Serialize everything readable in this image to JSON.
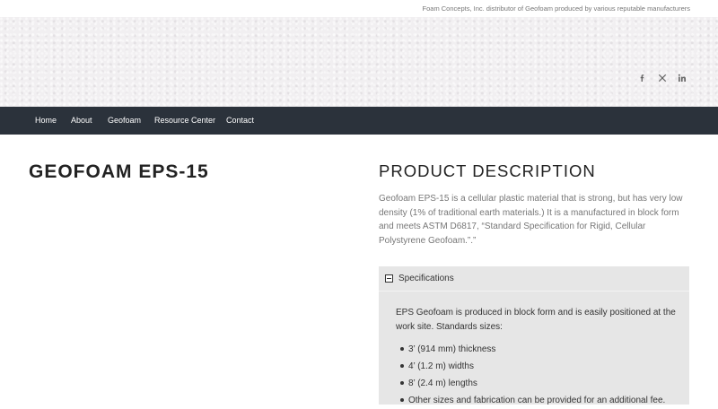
{
  "topbar": {
    "tagline": "Foam Concepts, Inc. distributor of Geofoam produced by various reputable manufacturers"
  },
  "social": {
    "icons": [
      "facebook-icon",
      "x-twitter-icon",
      "linkedin-icon"
    ]
  },
  "nav": {
    "items": [
      "Home",
      "About",
      "Geofoam",
      "Resource Center",
      "Contact"
    ]
  },
  "page": {
    "title": "GEOFOAM EPS-15"
  },
  "product": {
    "heading": "PRODUCT DESCRIPTION",
    "description": "Geofoam EPS-15 is a cellular plastic material that is strong, but has very low density (1% of traditional earth materials.) It is a manufactured in block form and meets ASTM D6817, “Standard Specification for Rigid, Cellular Polystyrene Geofoam.”.”"
  },
  "specs": {
    "label": "Specifications",
    "intro": "EPS Geofoam is produced in block form and is easily positioned at the work site. Standards sizes:",
    "items": [
      "3’ (914 mm) thickness",
      "4’ (1.2 m) widths",
      "8’ (2.4 m) lengths",
      "Other sizes and fabrication can be provided for an additional fee."
    ]
  },
  "colors": {
    "nav_bg": "#2b323b",
    "hero_bg": "#f1eff1",
    "accordion_bg": "#e6e6e6"
  }
}
